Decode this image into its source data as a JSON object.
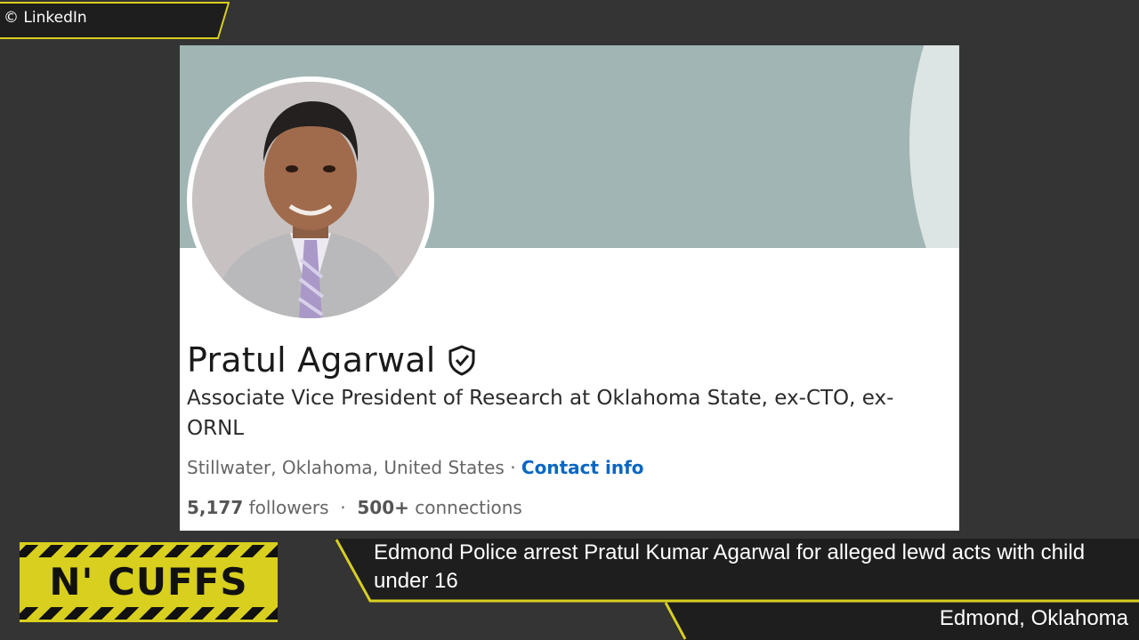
{
  "credit": {
    "text": "© LinkedIn"
  },
  "profile": {
    "name": "Pratul Agarwal",
    "headline": "Associate Vice President of Research at Oklahoma State, ex-CTO, ex-ORNL",
    "location": "Stillwater, Oklahoma, United States",
    "separator": " · ",
    "contact_label": "Contact info",
    "followers": "5,177",
    "followers_label": "followers",
    "connections": "500+",
    "connections_label": "connections",
    "verified_icon": "shield-check-icon"
  },
  "logo": {
    "text": "N' CUFFS"
  },
  "news": {
    "headline": "Edmond Police arrest Pratul Kumar Agarwal for alleged lewd acts with child under 16",
    "location": "Edmond, Oklahoma"
  },
  "colors": {
    "background": "#343434",
    "accent_yellow": "#d8cf1e",
    "link_blue": "#0a66c2",
    "banner": "#a1b6b4"
  }
}
